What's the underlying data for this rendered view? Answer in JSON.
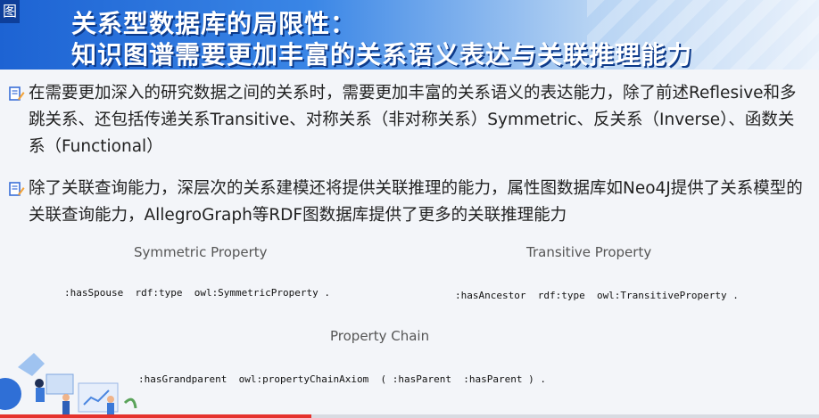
{
  "header": {
    "corner_tag": "图",
    "title_line1": "关系型数据库的局限性：",
    "title_line2": "知识图谱需要更加丰富的关系语义表达与关联推理能力"
  },
  "bullets": [
    "在需要更加深入的研究数据之间的关系时，需要更加丰富的关系语义的表达能力，除了前述Reflesive和多跳关系、还包括传递关系Transitive、对称关系（非对称关系）Symmetric、反关系（Inverse）、函数关系（Functional）",
    "除了关联查询能力，深层次的关系建模还将提供关联推理的能力，属性图数据库如Neo4J提供了关系模型的关联查询能力，AllegroGraph等RDF图数据库提供了更多的关联推理能力"
  ],
  "examples": {
    "symmetric": {
      "label": "Symmetric Property",
      "code": ":hasSpouse  rdf:type  owl:SymmetricProperty ."
    },
    "transitive": {
      "label": "Transitive Property",
      "code": ":hasAncestor  rdf:type  owl:TransitiveProperty ."
    },
    "chain": {
      "label": "Property Chain",
      "code": ":hasGrandparent  owl:propertyChainAxiom  ( :hasParent  :hasParent ) ."
    }
  },
  "video_progress": 0.38,
  "colors": {
    "header_blue": "#1d63d3",
    "progress_red": "#e5322d",
    "bullet_blue": "#3b6fd8"
  },
  "icons": {
    "bullet": "note-pencil-icon",
    "illustration": "office-people-illustration"
  }
}
